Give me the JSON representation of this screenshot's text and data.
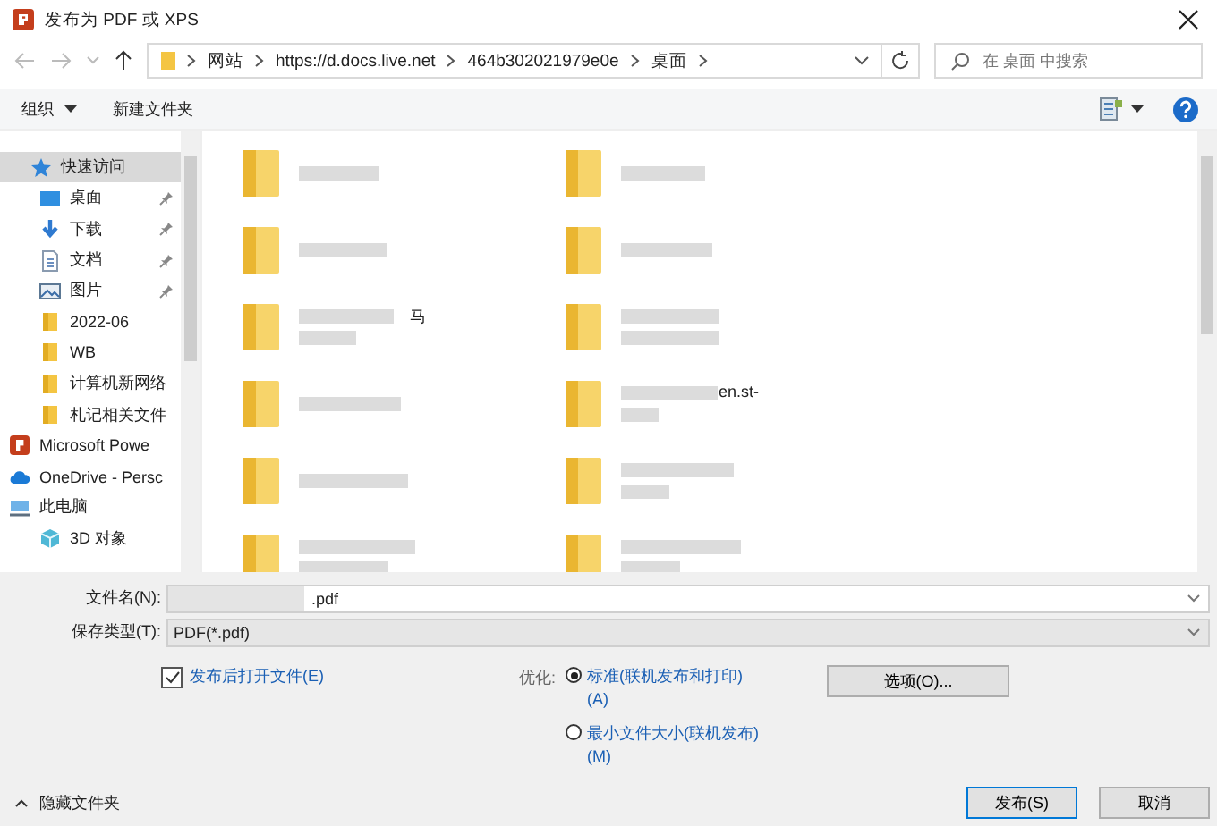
{
  "window": {
    "title": "发布为 PDF 或 XPS"
  },
  "address": {
    "crumbs": [
      "网站",
      "https://d.docs.live.net",
      "464b302021979e0e",
      "桌面"
    ],
    "search_placeholder": "在 桌面 中搜索"
  },
  "toolbar": {
    "organize": "组织",
    "new_folder": "新建文件夹"
  },
  "sidebar": {
    "items": [
      {
        "label": "快速访问",
        "kind": "star",
        "selected": true,
        "pinned": false,
        "children": [
          {
            "label": "桌面",
            "kind": "desktop",
            "selected": false,
            "pinned": true
          },
          {
            "label": "下载",
            "kind": "download",
            "selected": false,
            "pinned": true
          },
          {
            "label": "文档",
            "kind": "doc",
            "selected": false,
            "pinned": true
          },
          {
            "label": "图片",
            "kind": "picture",
            "selected": false,
            "pinned": true
          },
          {
            "label": "2022-06",
            "kind": "folder",
            "selected": false,
            "pinned": false
          },
          {
            "label": "WB",
            "kind": "folder",
            "selected": false,
            "pinned": false
          },
          {
            "label": "计算机新网络",
            "kind": "folder",
            "selected": false,
            "pinned": false
          },
          {
            "label": "札记相关文件",
            "kind": "folder",
            "selected": false,
            "pinned": false
          }
        ]
      },
      {
        "label": "Microsoft Powe",
        "kind": "ppt",
        "selected": false,
        "pinned": false
      },
      {
        "label": "OneDrive - Persc",
        "kind": "cloud",
        "selected": false,
        "pinned": false
      },
      {
        "label": "此电脑",
        "kind": "pc",
        "selected": false,
        "pinned": false,
        "children": [
          {
            "label": "3D 对象",
            "kind": "cube",
            "selected": false,
            "pinned": false
          }
        ]
      }
    ]
  },
  "file_name_fragments": [
    "马",
    "en.st-"
  ],
  "form": {
    "filename_label": "文件名(N):",
    "filename_value": ".pdf",
    "type_label": "保存类型(T):",
    "type_value": "PDF(*.pdf)",
    "open_after": {
      "label": "发布后打开文件(E)",
      "checked": true
    },
    "optimize_label": "优化:",
    "options": [
      {
        "label": "标准(联机发布和打印)(A)",
        "selected": true
      },
      {
        "label": "最小文件大小(联机发布)(M)",
        "selected": false
      }
    ],
    "options_button": "选项(O)...",
    "hide_folders": "隐藏文件夹",
    "publish": "发布(S)",
    "cancel": "取消"
  }
}
